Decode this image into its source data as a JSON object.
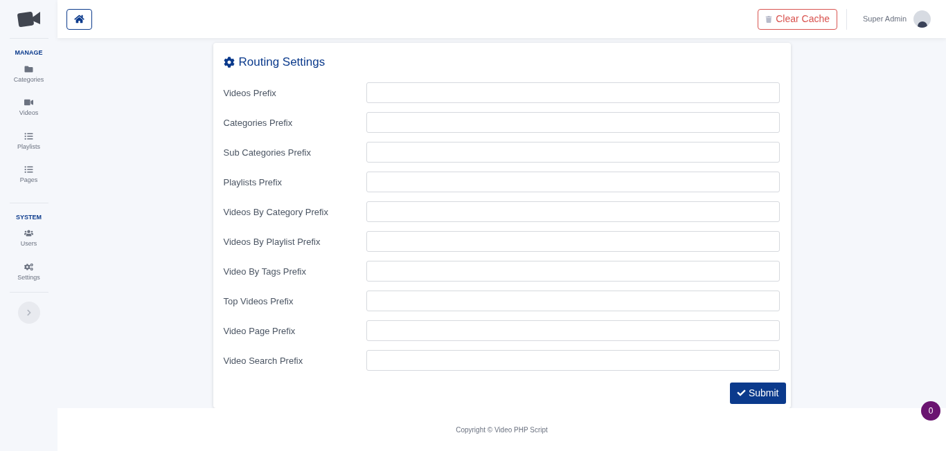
{
  "sidebar": {
    "sections": [
      {
        "title": "MANAGE",
        "items": [
          {
            "label": "Categories"
          },
          {
            "label": "Videos"
          },
          {
            "label": "Playlists"
          },
          {
            "label": "Pages"
          }
        ]
      },
      {
        "title": "SYSTEM",
        "items": [
          {
            "label": "Users"
          },
          {
            "label": "Settings"
          }
        ]
      }
    ]
  },
  "header": {
    "clear_cache": "Clear Cache",
    "user_name": "Super Admin"
  },
  "card": {
    "title": "Routing Settings",
    "fields": [
      {
        "label": "Videos Prefix"
      },
      {
        "label": "Categories Prefix"
      },
      {
        "label": "Sub Categories Prefix"
      },
      {
        "label": "Playlists Prefix"
      },
      {
        "label": "Videos By Category Prefix"
      },
      {
        "label": "Videos By Playlist Prefix"
      },
      {
        "label": "Video By Tags Prefix"
      },
      {
        "label": "Top Videos Prefix"
      },
      {
        "label": "Video Page Prefix"
      },
      {
        "label": "Video Search Prefix"
      }
    ],
    "submit": "Submit"
  },
  "footer": "Copyright © Video PHP Script",
  "badge": "0"
}
